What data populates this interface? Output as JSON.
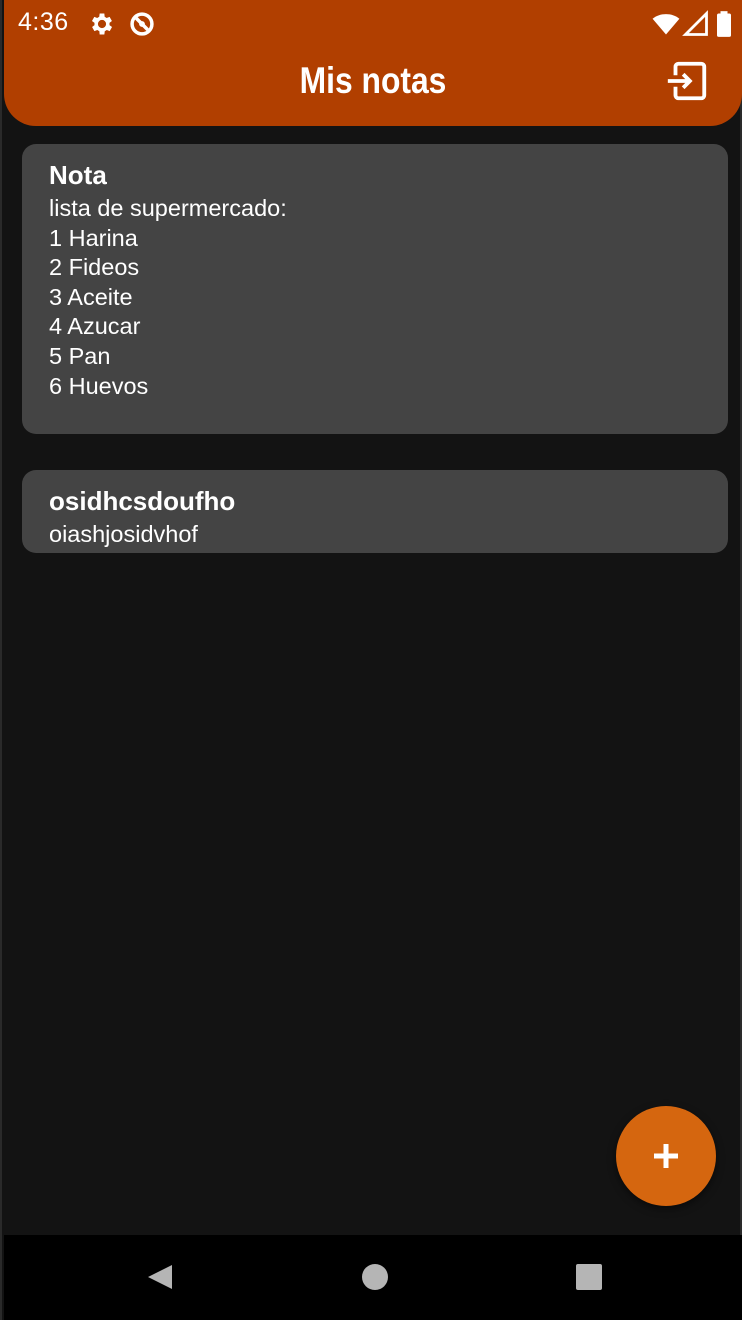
{
  "status_bar": {
    "time": "4:36",
    "icons": [
      "settings-icon",
      "sync-icon",
      "wifi-icon",
      "signal-icon",
      "battery-icon"
    ]
  },
  "app_bar": {
    "title": "Mis notas",
    "action_icon": "logout-icon",
    "background_color": "#b13f00"
  },
  "notes": [
    {
      "title": "Nota",
      "body": "lista de supermercado:\n1 Harina\n2 Fideos\n3 Aceite\n4 Azucar\n5 Pan\n6 Huevos"
    },
    {
      "title": "osidhcsdoufho",
      "body": "oiashjosidvhof"
    }
  ],
  "fab": {
    "icon": "plus-icon",
    "color": "#d5660f"
  },
  "nav_bar": {
    "buttons": [
      "back-icon",
      "home-icon",
      "recents-icon"
    ]
  },
  "colors": {
    "background": "#131313",
    "card": "#444444",
    "text": "#ffffff"
  }
}
